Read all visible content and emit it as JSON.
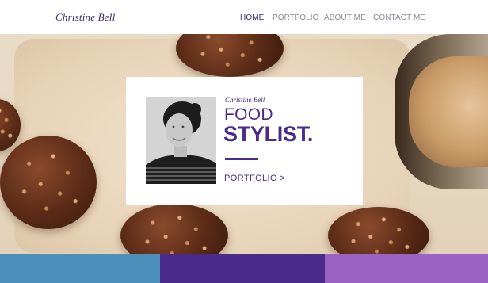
{
  "header": {
    "brand": "Christine Bell",
    "nav": [
      {
        "label": "HOME",
        "active": true
      },
      {
        "label": "PORTFOLIO",
        "active": false
      },
      {
        "label": "ABOUT ME",
        "active": false
      },
      {
        "label": "CONTACT ME",
        "active": false
      }
    ]
  },
  "card": {
    "name": "Christine Bell",
    "title_line1": "FOOD",
    "title_line2": "STYLIST.",
    "link": "PORTFOLIO >"
  },
  "colors": {
    "accent": "#4a2a8a",
    "band_blue": "#4a90bb",
    "band_purple": "#4a2a8a",
    "band_lilac": "#9b62c6"
  }
}
